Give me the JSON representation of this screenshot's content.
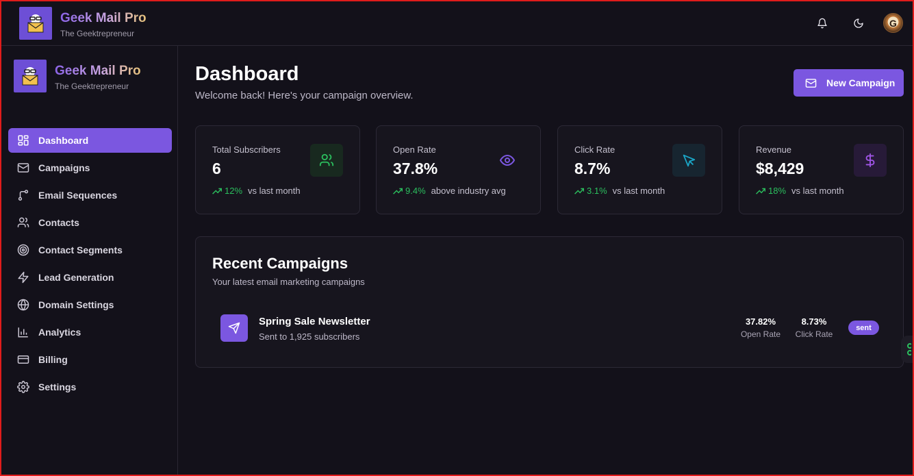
{
  "app": {
    "title": "Geek Mail Pro",
    "subtitle": "The Geektrepreneur"
  },
  "topbar": {
    "icons": [
      "bell-icon",
      "moon-icon"
    ],
    "avatar_letter": "G"
  },
  "sidebar": {
    "items": [
      {
        "label": "Dashboard",
        "icon": "dashboard-grid-icon",
        "active": true
      },
      {
        "label": "Campaigns",
        "icon": "mail-icon",
        "active": false
      },
      {
        "label": "Email Sequences",
        "icon": "branch-icon",
        "active": false
      },
      {
        "label": "Contacts",
        "icon": "users-icon",
        "active": false
      },
      {
        "label": "Contact Segments",
        "icon": "target-icon",
        "active": false
      },
      {
        "label": "Lead Generation",
        "icon": "zap-icon",
        "active": false
      },
      {
        "label": "Domain Settings",
        "icon": "globe-icon",
        "active": false
      },
      {
        "label": "Analytics",
        "icon": "bar-chart-icon",
        "active": false
      },
      {
        "label": "Billing",
        "icon": "credit-card-icon",
        "active": false
      },
      {
        "label": "Settings",
        "icon": "gear-icon",
        "active": false
      }
    ]
  },
  "main": {
    "title": "Dashboard",
    "subtitle": "Welcome back! Here's your campaign overview.",
    "new_campaign_label": "New Campaign",
    "stats": [
      {
        "label": "Total Subscribers",
        "value": "6",
        "trend": "12%",
        "trend_text": "vs last month",
        "icon": "users-icon",
        "color": "#2bbf5e"
      },
      {
        "label": "Open Rate",
        "value": "37.8%",
        "trend": "9.4%",
        "trend_text": "above industry avg",
        "icon": "eye-icon",
        "color": "#7b57e0"
      },
      {
        "label": "Click Rate",
        "value": "8.7%",
        "trend": "3.1%",
        "trend_text": "vs last month",
        "icon": "cursor-icon",
        "color": "#1aa6c7"
      },
      {
        "label": "Revenue",
        "value": "$8,429",
        "trend": "18%",
        "trend_text": "vs last month",
        "icon": "dollar-icon",
        "color": "#a155e8"
      }
    ],
    "recent": {
      "title": "Recent Campaigns",
      "subtitle": "Your latest email marketing campaigns",
      "campaigns": [
        {
          "name": "Spring Sale Newsletter",
          "sent_text": "Sent to 1,925 subscribers",
          "open_rate": "37.82%",
          "open_rate_label": "Open Rate",
          "click_rate": "8.73%",
          "click_rate_label": "Click Rate",
          "status": "sent"
        }
      ]
    }
  },
  "colors": {
    "accent": "#7b57e0",
    "background": "#13111a",
    "card": "#17151e",
    "positive": "#2bbf5e"
  }
}
